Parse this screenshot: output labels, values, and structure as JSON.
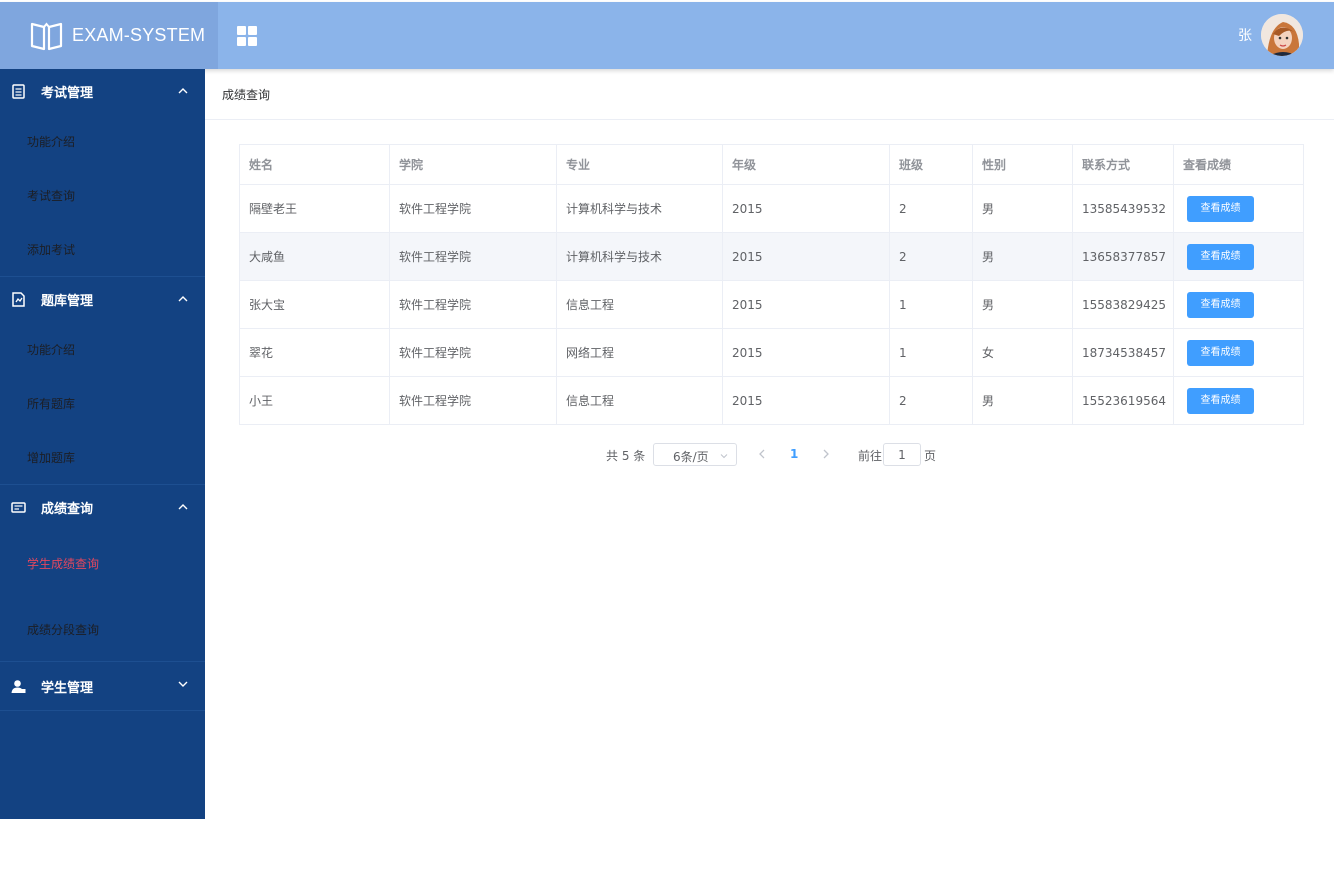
{
  "header": {
    "app_title": "EXAM-SYSTEM",
    "user_name": "张",
    "bg_color": "#8bb4ea"
  },
  "sidebar": {
    "groups": [
      {
        "title": "考试管理",
        "icon": "exam-list-icon",
        "expanded": true,
        "items": [
          {
            "label": "功能介绍"
          },
          {
            "label": "考试查询"
          },
          {
            "label": "添加考试"
          }
        ]
      },
      {
        "title": "题库管理",
        "icon": "question-bank-icon",
        "expanded": true,
        "items": [
          {
            "label": "功能介绍"
          },
          {
            "label": "所有题库"
          },
          {
            "label": "增加题库"
          }
        ]
      },
      {
        "title": "成绩查询",
        "icon": "score-card-icon",
        "expanded": true,
        "items": [
          {
            "label": "学生成绩查询",
            "active": true
          },
          {
            "label": "成绩分段查询"
          }
        ]
      },
      {
        "title": "学生管理",
        "icon": "student-icon",
        "expanded": false,
        "items": []
      }
    ]
  },
  "breadcrumb": "成绩查询",
  "table": {
    "columns": [
      "姓名",
      "学院",
      "专业",
      "年级",
      "班级",
      "性别",
      "联系方式",
      "查看成绩"
    ],
    "rows": [
      [
        "隔壁老王",
        "软件工程学院",
        "计算机科学与技术",
        "2015",
        "2",
        "男",
        "13585439532"
      ],
      [
        "大咸鱼",
        "软件工程学院",
        "计算机科学与技术",
        "2015",
        "2",
        "男",
        "13658377857"
      ],
      [
        "张大宝",
        "软件工程学院",
        "信息工程",
        "2015",
        "1",
        "男",
        "15583829425"
      ],
      [
        "翠花",
        "软件工程学院",
        "网络工程",
        "2015",
        "1",
        "女",
        "18734538457"
      ],
      [
        "小王",
        "软件工程学院",
        "信息工程",
        "2015",
        "2",
        "男",
        "15523619564"
      ]
    ],
    "action_label": "查看成绩"
  },
  "pagination": {
    "total_text": "共 5 条",
    "page_size": "6条/页",
    "current_page": "1",
    "goto_label": "前往",
    "goto_value": "1",
    "page_suffix": "页"
  }
}
